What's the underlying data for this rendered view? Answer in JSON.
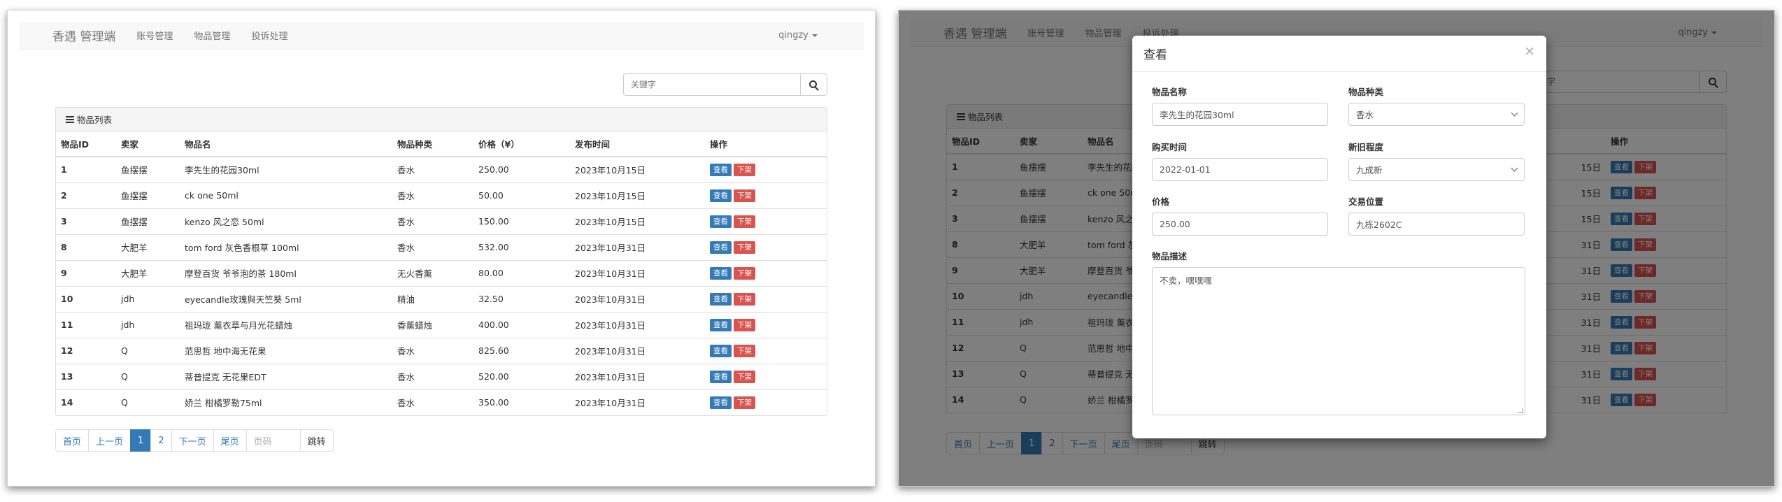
{
  "app": {
    "brand": "香遇 管理端",
    "nav": [
      "账号管理",
      "物品管理",
      "投诉处理"
    ],
    "user": "qingzy"
  },
  "search": {
    "placeholder": "关键字"
  },
  "list": {
    "title": "物品列表",
    "columns": [
      "物品ID",
      "卖家",
      "物品名",
      "物品种类",
      "价格（¥）",
      "发布时间",
      "操作"
    ],
    "view_label": "查看",
    "off_label": "下架",
    "rows": [
      {
        "id": "1",
        "seller": "鱼摆摆",
        "name": "李先生的花园30ml",
        "category": "香水",
        "price": "250.00",
        "date": "2023年10月15日"
      },
      {
        "id": "2",
        "seller": "鱼摆摆",
        "name": "ck one 50ml",
        "category": "香水",
        "price": "50.00",
        "date": "2023年10月15日"
      },
      {
        "id": "3",
        "seller": "鱼摆摆",
        "name": "kenzo 风之恋 50ml",
        "category": "香水",
        "price": "150.00",
        "date": "2023年10月15日"
      },
      {
        "id": "8",
        "seller": "大肥羊",
        "name": "tom ford 灰色香根草 100ml",
        "category": "香水",
        "price": "532.00",
        "date": "2023年10月31日"
      },
      {
        "id": "9",
        "seller": "大肥羊",
        "name": "摩登百货 爷爷泡的茶 180ml",
        "category": "无火香薰",
        "price": "80.00",
        "date": "2023年10月31日"
      },
      {
        "id": "10",
        "seller": "jdh",
        "name": "eyecandle玫瑰與天竺葵 5ml",
        "category": "精油",
        "price": "32.50",
        "date": "2023年10月31日"
      },
      {
        "id": "11",
        "seller": "jdh",
        "name": "祖玛珑 薰衣草与月光花蜡烛",
        "category": "香薰蜡烛",
        "price": "400.00",
        "date": "2023年10月31日"
      },
      {
        "id": "12",
        "seller": "Q",
        "name": "范思哲 地中海无花果",
        "category": "香水",
        "price": "825.60",
        "date": "2023年10月31日"
      },
      {
        "id": "13",
        "seller": "Q",
        "name": "蒂普提克 无花果EDT",
        "category": "香水",
        "price": "520.00",
        "date": "2023年10月31日"
      },
      {
        "id": "14",
        "seller": "Q",
        "name": "娇兰 柑橘罗勒75ml",
        "category": "香水",
        "price": "350.00",
        "date": "2023年10月31日"
      }
    ]
  },
  "right_rows_visible": [
    {
      "id": "1",
      "seller": "鱼摆摆",
      "name": "李先生的花园30ml",
      "date": "15日"
    },
    {
      "id": "2",
      "seller": "鱼摆摆",
      "name": "ck one 50ml",
      "date": "15日"
    },
    {
      "id": "3",
      "seller": "鱼摆摆",
      "name": "kenzo 风之恋",
      "date": "15日"
    },
    {
      "id": "8",
      "seller": "大肥羊",
      "name": "tom ford 灰",
      "date": "31日"
    },
    {
      "id": "9",
      "seller": "大肥羊",
      "name": "摩登百货 爷",
      "date": "31日"
    },
    {
      "id": "10",
      "seller": "jdh",
      "name": "eyecandle",
      "date": "31日"
    },
    {
      "id": "11",
      "seller": "jdh",
      "name": "祖玛珑 薰衣",
      "date": "31日"
    },
    {
      "id": "12",
      "seller": "Q",
      "name": "范思哲 地中",
      "date": "31日"
    },
    {
      "id": "13",
      "seller": "Q",
      "name": "蒂普提克 无",
      "date": "31日"
    },
    {
      "id": "14",
      "seller": "Q",
      "name": "娇兰 柑橘罗",
      "date": "31日"
    }
  ],
  "pagination": {
    "first": "首页",
    "prev": "上一页",
    "pages": [
      "1",
      "2"
    ],
    "next": "下一页",
    "last": "尾页",
    "input_placeholder": "页码",
    "go": "跳转"
  },
  "modal": {
    "title": "查看",
    "close": "×",
    "name_label": "物品名称",
    "name_value": "李先生的花园30ml",
    "category_label": "物品种类",
    "category_value": "香水",
    "buy_time_label": "购买时间",
    "buy_time_value": "2022-01-01",
    "condition_label": "新旧程度",
    "condition_value": "九成新",
    "price_label": "价格",
    "price_value": "250.00",
    "location_label": "交易位置",
    "location_value": "九栋2602C",
    "desc_label": "物品描述",
    "desc_value": "不卖，嘿嘿嘿"
  }
}
